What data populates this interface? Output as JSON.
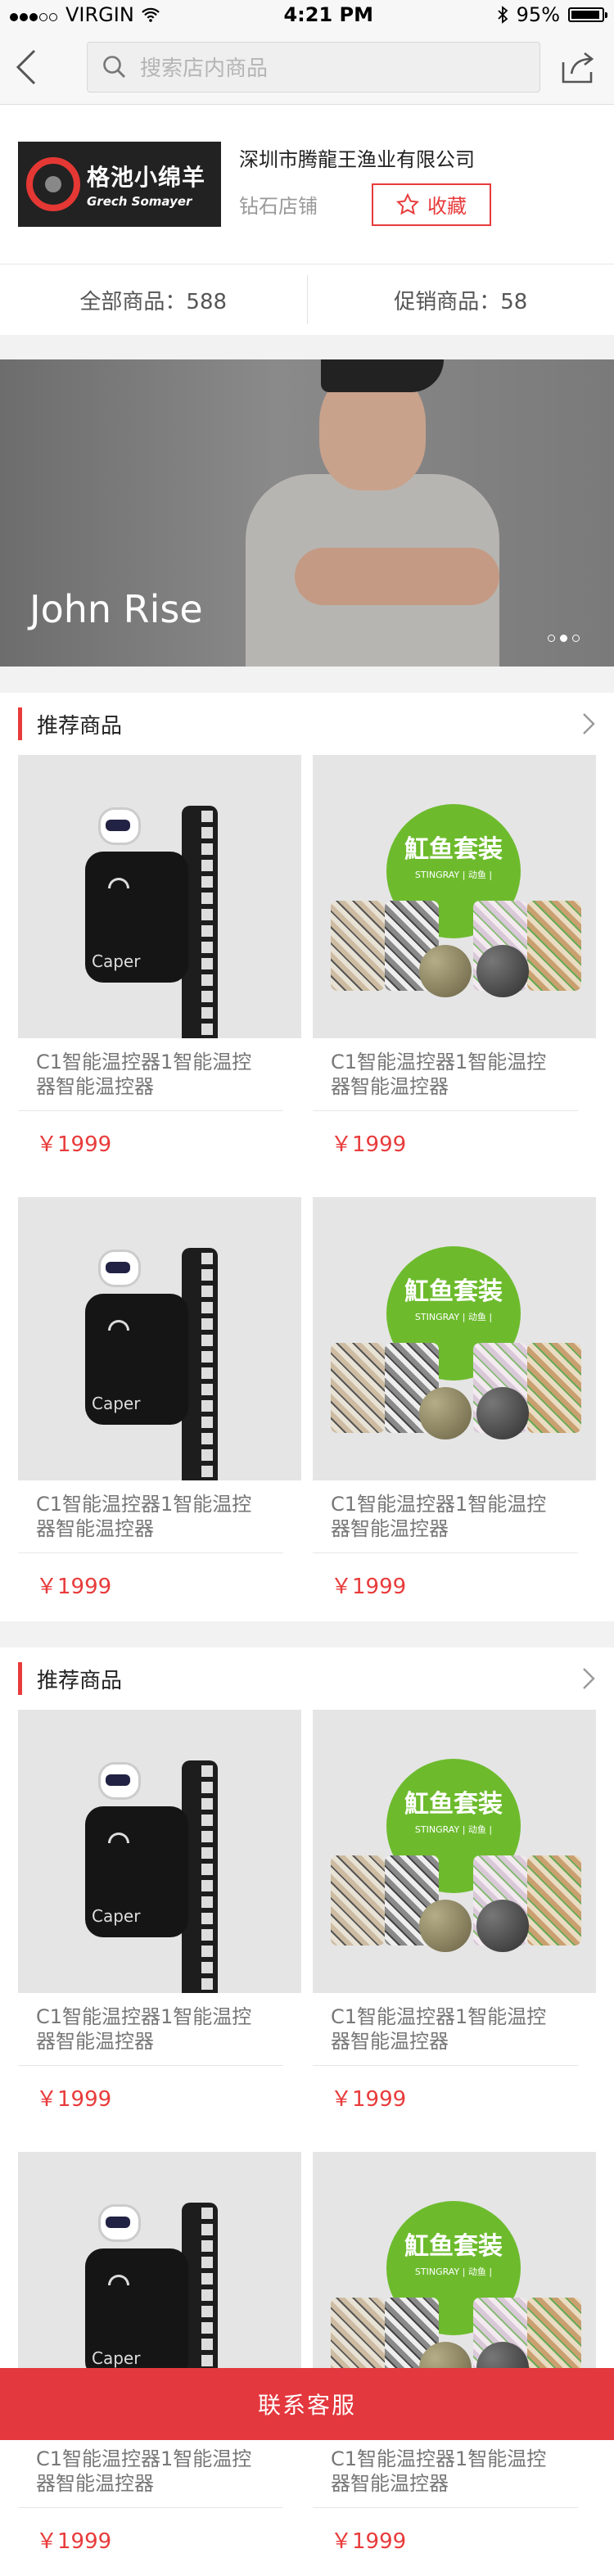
{
  "status": {
    "carrier": "VIRGIN",
    "time": "4:21 PM",
    "battery": "95%"
  },
  "nav": {
    "search_placeholder": "搜索店内商品"
  },
  "shop": {
    "logo_cn": "格池小绵羊",
    "logo_en": "Grech Somayer",
    "name": "深圳市腾龍王渔业有限公司",
    "level": "钻石店铺",
    "fav_label": "收藏"
  },
  "stats": {
    "all": "全部商品：588",
    "promo": "促销商品：58"
  },
  "banner": {
    "title": "John Rise",
    "slide_index": 2,
    "slide_count": 3
  },
  "sections": [
    {
      "title": "推荐商品",
      "items": [
        {
          "type": "heater",
          "name": "C1智能温控器1智能温控器智能温控器",
          "price": "￥1999",
          "brand": "Caper"
        },
        {
          "type": "stones",
          "name": "C1智能温控器1智能温控器智能温控器",
          "price": "￥1999",
          "badge": "魟鱼套装",
          "badge_sub": "STINGRAY | 动鱼 |"
        },
        {
          "type": "heater",
          "name": "C1智能温控器1智能温控器智能温控器",
          "price": "￥1999",
          "brand": "Caper"
        },
        {
          "type": "stones",
          "name": "C1智能温控器1智能温控器智能温控器",
          "price": "￥1999",
          "badge": "魟鱼套装",
          "badge_sub": "STINGRAY | 动鱼 |"
        }
      ]
    },
    {
      "title": "推荐商品",
      "items": [
        {
          "type": "heater",
          "name": "C1智能温控器1智能温控器智能温控器",
          "price": "￥1999",
          "brand": "Caper"
        },
        {
          "type": "stones",
          "name": "C1智能温控器1智能温控器智能温控器",
          "price": "￥1999",
          "badge": "魟鱼套装",
          "badge_sub": "STINGRAY | 动鱼 |"
        },
        {
          "type": "heater",
          "name": "C1智能温控器1智能温控器智能温控器",
          "price": "￥1999",
          "brand": "Caper"
        },
        {
          "type": "stones",
          "name": "C1智能温控器1智能温控器智能温控器",
          "price": "￥1999",
          "badge": "魟鱼套装",
          "badge_sub": "STINGRAY | 动鱼 |"
        }
      ]
    }
  ],
  "footer": {
    "label": "联系客服"
  },
  "colors": {
    "accent": "#e83b3b",
    "footer": "#e3383e",
    "badge_green": "#6dbb2d"
  }
}
